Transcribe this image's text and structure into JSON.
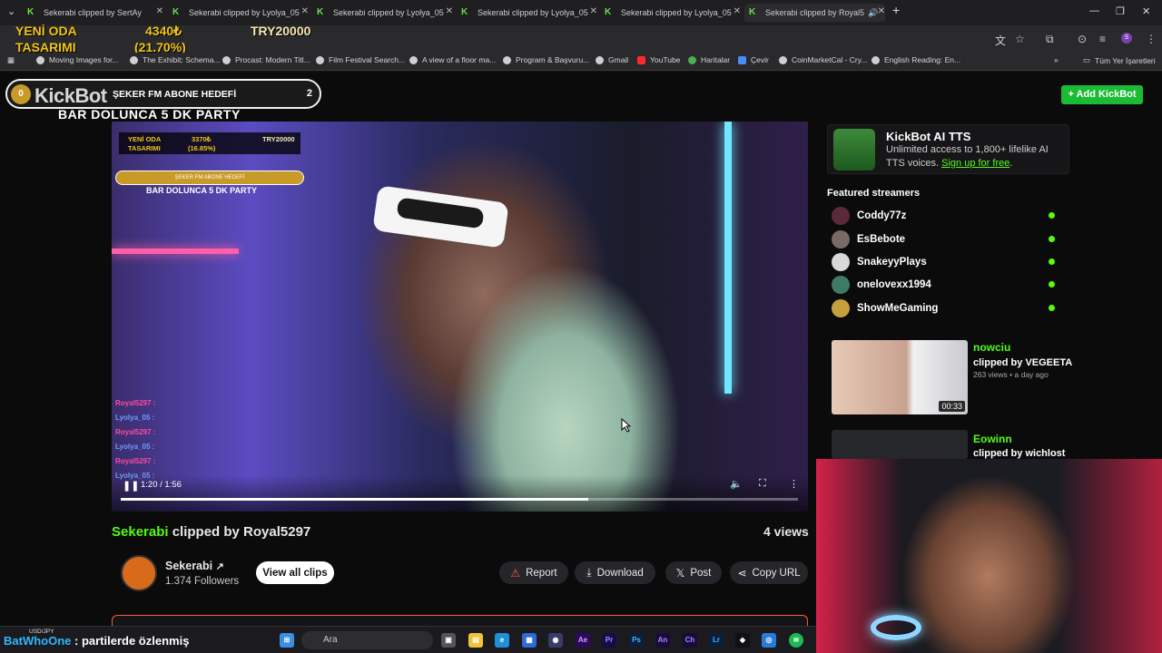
{
  "tabs": [
    {
      "label": "Sekerabi clipped by SertAy"
    },
    {
      "label": "Sekerabi clipped by Lyolya_05"
    },
    {
      "label": "Sekerabi clipped by Lyolya_05"
    },
    {
      "label": "Sekerabi clipped by Lyolya_05"
    },
    {
      "label": "Sekerabi clipped by Lyolya_05"
    },
    {
      "label": "Sekerabi clipped by Royal5"
    }
  ],
  "bookmarks": [
    {
      "label": "Moving Images for..."
    },
    {
      "label": "The Exhibit: Schema..."
    },
    {
      "label": "Procast: Modern Titl..."
    },
    {
      "label": "Film Festival Search..."
    },
    {
      "label": "A view of a floor ma..."
    },
    {
      "label": "Program & Başvuru..."
    },
    {
      "label": "Gmail"
    },
    {
      "label": "YouTube"
    },
    {
      "label": "Haritalar"
    },
    {
      "label": "Çevir"
    },
    {
      "label": "CoinMarketCal - Cry..."
    },
    {
      "label": "English Reading: En..."
    }
  ],
  "all_bookmarks_label": "Tüm Yer İşaretleri",
  "overlay": {
    "donation_title_1": "YENİ ODA",
    "donation_title_2": "TASARIMI",
    "donation_amount": "4340₺",
    "donation_percent": "(21.70%)",
    "donation_target": "TRY20000",
    "goal_count_left": "0",
    "kickbot_logo": "KickBot",
    "goal_label": "ŞEKER FM ABONE HEDEFİ",
    "goal_count_right": "2",
    "party_text": "BAR DOLUNCA 5 DK PARTY"
  },
  "video": {
    "mini_title_1": "YENİ ODA",
    "mini_title_2": "TASARIMI",
    "mini_amount": "3370₺",
    "mini_percent": "(16.85%)",
    "mini_target": "TRY20000",
    "mini_goal": "ŞEKER FM ABONE HEDEFİ",
    "mini_party": "BAR DOLUNCA 5 DK PARTY",
    "chat": [
      "Royal5297 :",
      "Lyolya_05 :",
      "Royal5297 :",
      "Lyolya_05 :",
      "Royal5297 :",
      "Lyolya_05 :"
    ],
    "time": "1:20 / 1:56",
    "progress": 0.69
  },
  "clip": {
    "streamer": "Sekerabi",
    "clipped_by": " clipped by Royal5297",
    "views": "4 views",
    "channel_name": "Sekerabi",
    "followers": "1.374 Followers",
    "view_all": "View all clips",
    "report": "Report",
    "download": "Download",
    "post": "Post",
    "copy_url": "Copy URL"
  },
  "sidebar": {
    "add_kickbot": "+ Add KickBot",
    "tts_title": "KickBot AI TTS",
    "tts_desc": "Unlimited access to 1,800+ lifelike AI TTS voices. ",
    "tts_link": "Sign up for free",
    "tts_period": ".",
    "featured_heading": "Featured streamers",
    "streamers": [
      {
        "name": "Coddy77z"
      },
      {
        "name": "EsBebote"
      },
      {
        "name": "SnakeyyPlays"
      },
      {
        "name": "onelovexx1994"
      },
      {
        "name": "ShowMeGaming"
      }
    ],
    "clips": [
      {
        "streamer": "nowciu",
        "by": "clipped by VEGEETA",
        "meta": "263 views • a day ago",
        "duration": "00:33"
      },
      {
        "streamer": "Eowinn",
        "by": "clipped by wichlost"
      }
    ]
  },
  "taskbar": {
    "usd": "USD/JPY",
    "marquee_nick": "BatWhoOne",
    "marquee_text": ": partilerde özlenmiş",
    "search": "Ara"
  },
  "colors": {
    "kick_green": "#53fc18",
    "button_green": "#1bbb34",
    "gold": "#f2c31a"
  }
}
